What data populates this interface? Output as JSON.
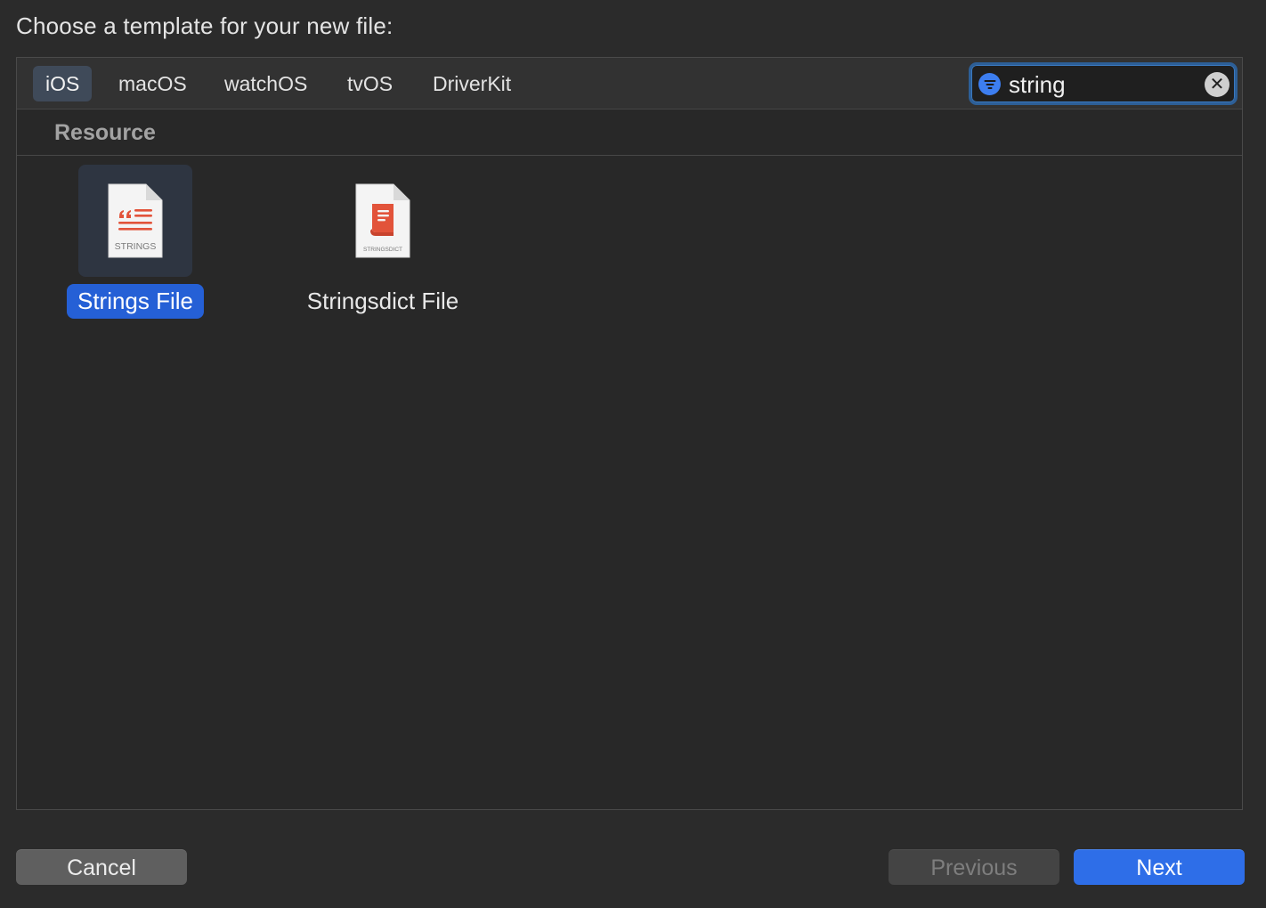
{
  "heading": "Choose a template for your new file:",
  "platform_tabs": [
    {
      "label": "iOS",
      "selected": true
    },
    {
      "label": "macOS",
      "selected": false
    },
    {
      "label": "watchOS",
      "selected": false
    },
    {
      "label": "tvOS",
      "selected": false
    },
    {
      "label": "DriverKit",
      "selected": false
    }
  ],
  "search": {
    "value": "string",
    "filter_icon": "filter-icon",
    "clear_icon": "clear-icon"
  },
  "section": {
    "title": "Resource"
  },
  "templates": [
    {
      "label": "Strings File",
      "badge": "STRINGS",
      "icon": "strings-file-icon",
      "selected": true
    },
    {
      "label": "Stringsdict File",
      "badge": "STRINGSDICT",
      "icon": "stringsdict-file-icon",
      "selected": false
    }
  ],
  "buttons": {
    "cancel": "Cancel",
    "previous": "Previous",
    "next": "Next"
  },
  "colors": {
    "accent": "#2e6ee8",
    "selection": "#2560d6",
    "file_icon_red": "#e2533a",
    "background": "#2b2b2b"
  }
}
